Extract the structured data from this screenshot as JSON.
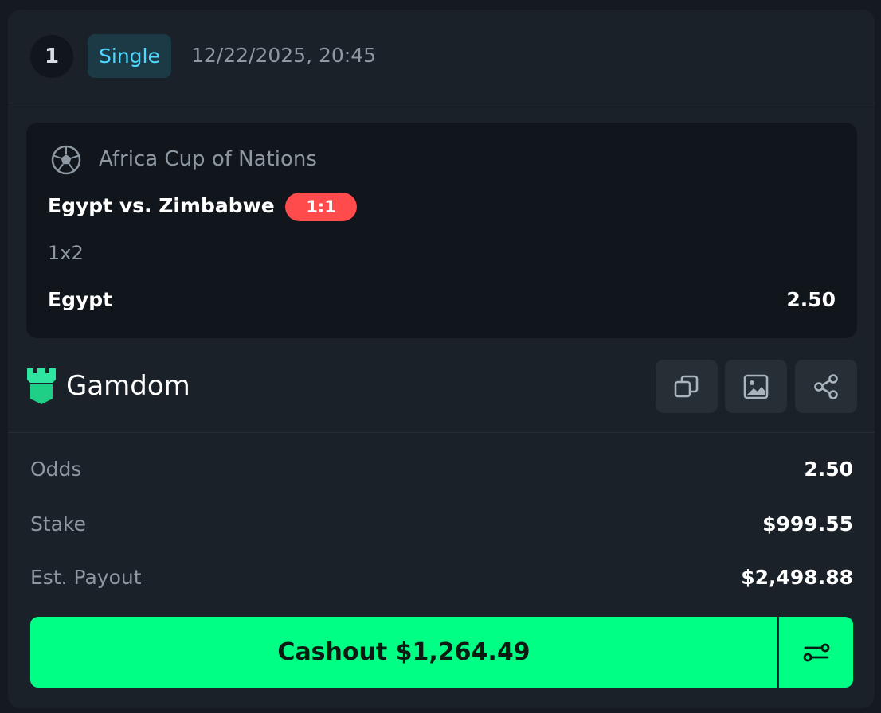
{
  "bet": {
    "number": "1",
    "type": "Single",
    "timestamp": "12/22/2025, 20:45"
  },
  "event": {
    "sport_icon": "soccer-ball-icon",
    "league": "Africa Cup of Nations",
    "match": "Egypt vs. Zimbabwe",
    "score": "1:1",
    "score_color": "#ff4b4b",
    "market": "1x2",
    "selection": "Egypt",
    "odds": "2.50"
  },
  "brand": {
    "name": "Gamdom",
    "logo_icon": "gamdom-castle-logo",
    "accent": "#2ee6a0"
  },
  "actions": {
    "icons": [
      "copy-icon",
      "image-icon",
      "share-icon"
    ]
  },
  "summary": {
    "odds_label": "Odds",
    "odds_value": "2.50",
    "stake_label": "Stake",
    "stake_value": "$999.55",
    "payout_label": "Est. Payout",
    "payout_value": "$2,498.88"
  },
  "cashout": {
    "label": "Cashout $1,264.49",
    "color": "#00ff85",
    "settings_icon": "sliders-icon"
  }
}
